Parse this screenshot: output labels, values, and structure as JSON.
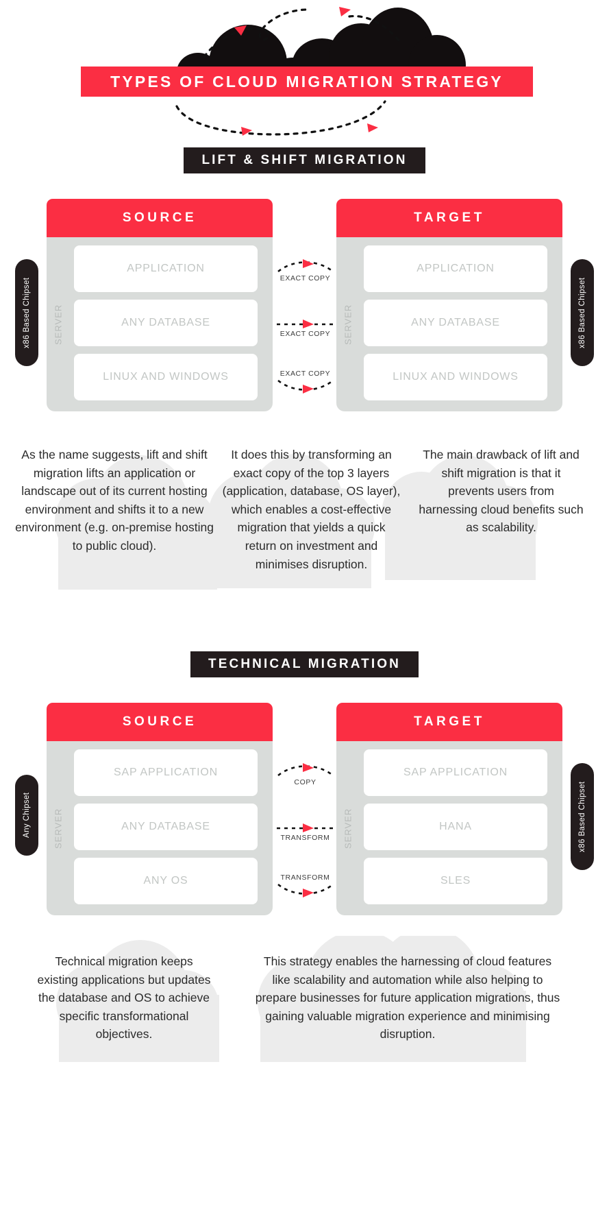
{
  "title": {
    "banner_text": "TYPES OF CLOUD MIGRATION STRATEGY"
  },
  "colors": {
    "accent_red": "#fb2e43",
    "dark": "#231c1d",
    "panel_gray": "#d9dcda",
    "layer_text": "#c2c6c4",
    "cloud_light": "#ececec"
  },
  "sections": [
    {
      "heading": "LIFT & SHIFT MIGRATION",
      "left_pill": "x86 Based Chipset",
      "right_pill": "x86 Based Chipset",
      "source": {
        "title": "SOURCE",
        "server_label": "SERVER",
        "layers": [
          "APPLICATION",
          "ANY DATABASE",
          "LINUX AND WINDOWS"
        ]
      },
      "target": {
        "title": "TARGET",
        "server_label": "SERVER",
        "layers": [
          "APPLICATION",
          "ANY DATABASE",
          "LINUX AND WINDOWS"
        ]
      },
      "connectors": [
        "EXACT COPY",
        "EXACT COPY",
        "EXACT COPY"
      ],
      "paragraphs": [
        "As the name suggests, lift and shift migration lifts an application or landscape out of its current hosting environment and shifts it to a new environment (e.g. on-premise hosting to public cloud).",
        "It does this by transforming an exact copy of the top 3 layers (application, database, OS layer), which enables a cost-effective migration that yields a quick return on investment and minimises disruption.",
        "The main drawback of lift and shift migration is that it prevents users from harnessing cloud benefits such as scalability."
      ]
    },
    {
      "heading": "TECHNICAL MIGRATION",
      "left_pill": "Any Chipset",
      "right_pill": "x86 Based Chipset",
      "source": {
        "title": "SOURCE",
        "server_label": "SERVER",
        "layers": [
          "SAP APPLICATION",
          "ANY DATABASE",
          "ANY OS"
        ]
      },
      "target": {
        "title": "TARGET",
        "server_label": "SERVER",
        "layers": [
          "SAP APPLICATION",
          "HANA",
          "SLES"
        ]
      },
      "connectors": [
        "COPY",
        "TRANSFORM",
        "TRANSFORM"
      ],
      "paragraphs": [
        "Technical migration keeps existing applications but updates the database and OS to achieve specific transformational objectives.",
        "This strategy enables the harnessing of cloud features like scalability and automation while also helping to prepare businesses for future application migrations, thus gaining valuable migration experience and minimising disruption."
      ]
    }
  ]
}
